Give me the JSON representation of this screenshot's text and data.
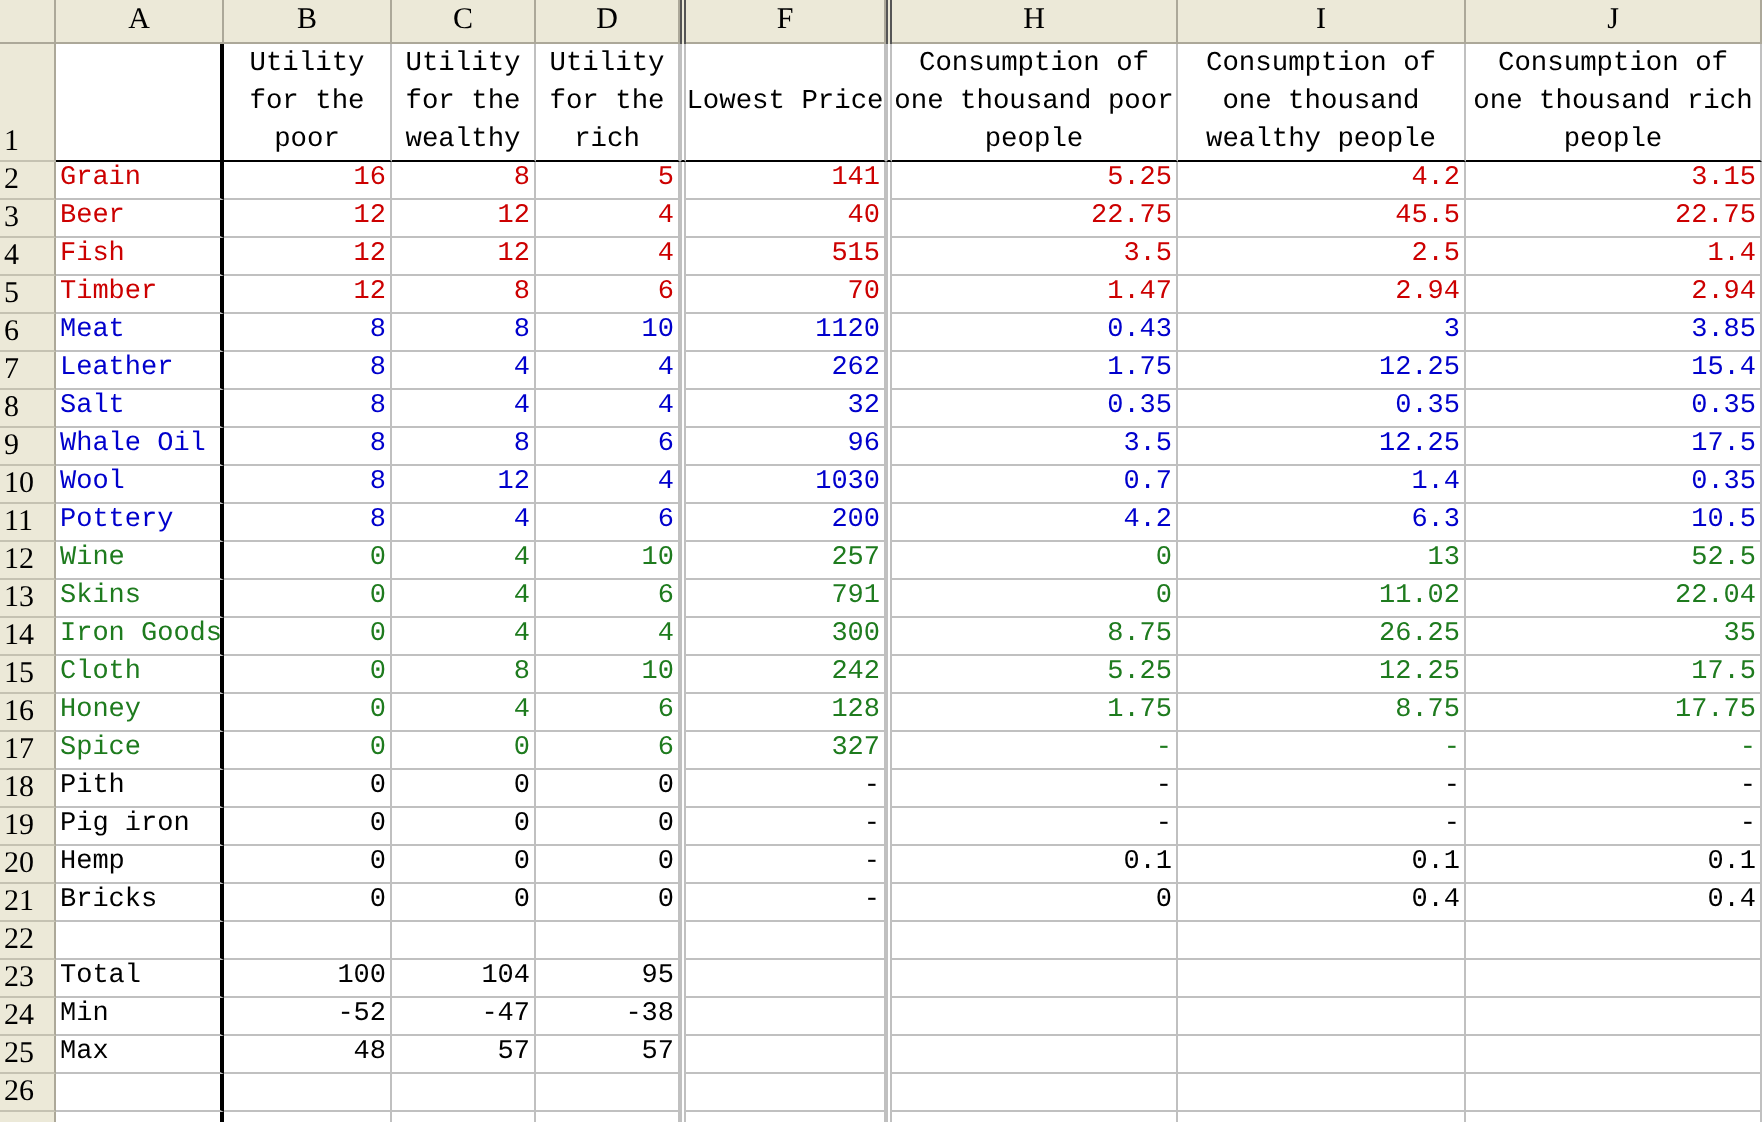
{
  "columns": [
    "A",
    "B",
    "C",
    "D",
    "F",
    "H",
    "I",
    "J"
  ],
  "header_row": {
    "number": "1",
    "cells": [
      null,
      "Utility for the poor",
      "Utility for the wealthy",
      "Utility for the rich",
      "Lowest Price",
      "Consumption of one thousand poor people",
      "Consumption of one thousand wealthy people",
      "Consumption of one thousand rich people"
    ]
  },
  "rows": [
    {
      "number": "2",
      "color": "#cc0000",
      "cells": [
        "Grain",
        "16",
        "8",
        "5",
        "141",
        "5.25",
        "4.2",
        "3.15"
      ]
    },
    {
      "number": "3",
      "color": "#cc0000",
      "cells": [
        "Beer",
        "12",
        "12",
        "4",
        "40",
        "22.75",
        "45.5",
        "22.75"
      ]
    },
    {
      "number": "4",
      "color": "#cc0000",
      "cells": [
        "Fish",
        "12",
        "12",
        "4",
        "515",
        "3.5",
        "2.5",
        "1.4"
      ]
    },
    {
      "number": "5",
      "color": "#cc0000",
      "cells": [
        "Timber",
        "12",
        "8",
        "6",
        "70",
        "1.47",
        "2.94",
        "2.94"
      ]
    },
    {
      "number": "6",
      "color": "#0000cc",
      "cells": [
        "Meat",
        "8",
        "8",
        "10",
        "1120",
        "0.43",
        "3",
        "3.85"
      ]
    },
    {
      "number": "7",
      "color": "#0000cc",
      "cells": [
        "Leather",
        "8",
        "4",
        "4",
        "262",
        "1.75",
        "12.25",
        "15.4"
      ]
    },
    {
      "number": "8",
      "color": "#0000cc",
      "cells": [
        "Salt",
        "8",
        "4",
        "4",
        "32",
        "0.35",
        "0.35",
        "0.35"
      ]
    },
    {
      "number": "9",
      "color": "#0000cc",
      "cells": [
        "Whale Oil",
        "8",
        "8",
        "6",
        "96",
        "3.5",
        "12.25",
        "17.5"
      ]
    },
    {
      "number": "10",
      "color": "#0000cc",
      "cells": [
        "Wool",
        "8",
        "12",
        "4",
        "1030",
        "0.7",
        "1.4",
        "0.35"
      ]
    },
    {
      "number": "11",
      "color": "#0000cc",
      "cells": [
        "Pottery",
        "8",
        "4",
        "6",
        "200",
        "4.2",
        "6.3",
        "10.5"
      ]
    },
    {
      "number": "12",
      "color": "#1e7b1e",
      "cells": [
        "Wine",
        "0",
        "4",
        "10",
        "257",
        "0",
        "13",
        "52.5"
      ]
    },
    {
      "number": "13",
      "color": "#1e7b1e",
      "cells": [
        "Skins",
        "0",
        "4",
        "6",
        "791",
        "0",
        "11.02",
        "22.04"
      ]
    },
    {
      "number": "14",
      "color": "#1e7b1e",
      "cells": [
        "Iron Goods",
        "0",
        "4",
        "4",
        "300",
        "8.75",
        "26.25",
        "35"
      ]
    },
    {
      "number": "15",
      "color": "#1e7b1e",
      "cells": [
        "Cloth",
        "0",
        "8",
        "10",
        "242",
        "5.25",
        "12.25",
        "17.5"
      ]
    },
    {
      "number": "16",
      "color": "#1e7b1e",
      "cells": [
        "Honey",
        "0",
        "4",
        "6",
        "128",
        "1.75",
        "8.75",
        "17.75"
      ]
    },
    {
      "number": "17",
      "color": "#1e7b1e",
      "cells": [
        "Spice",
        "0",
        "0",
        "6",
        "327",
        "-",
        "-",
        "-"
      ]
    },
    {
      "number": "18",
      "color": "#000000",
      "cells": [
        "Pith",
        "0",
        "0",
        "0",
        "-",
        "-",
        "-",
        "-"
      ]
    },
    {
      "number": "19",
      "color": "#000000",
      "cells": [
        "Pig iron",
        "0",
        "0",
        "0",
        "-",
        "-",
        "-",
        "-"
      ]
    },
    {
      "number": "20",
      "color": "#000000",
      "cells": [
        "Hemp",
        "0",
        "0",
        "0",
        "-",
        "0.1",
        "0.1",
        "0.1"
      ]
    },
    {
      "number": "21",
      "color": "#000000",
      "cells": [
        "Bricks",
        "0",
        "0",
        "0",
        "-",
        "0",
        "0.4",
        "0.4"
      ]
    },
    {
      "number": "22",
      "cells": [
        null,
        null,
        null,
        null,
        null,
        null,
        null,
        null
      ]
    },
    {
      "number": "23",
      "cells": [
        "Total",
        "100",
        "104",
        "95",
        null,
        null,
        null,
        null
      ]
    },
    {
      "number": "24",
      "cells": [
        "Min",
        "-52",
        "-47",
        "-38",
        null,
        null,
        null,
        null
      ]
    },
    {
      "number": "25",
      "cells": [
        "Max",
        "48",
        "57",
        "57",
        null,
        null,
        null,
        null
      ]
    },
    {
      "number": "26",
      "cells": [
        null,
        null,
        null,
        null,
        null,
        null,
        null,
        null
      ]
    }
  ]
}
